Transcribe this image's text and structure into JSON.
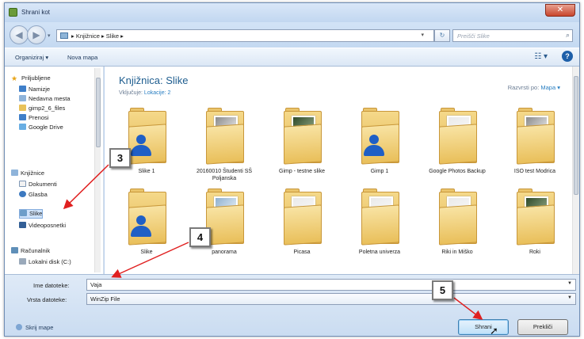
{
  "window": {
    "title": "Shrani kot",
    "close_symbol": "✕"
  },
  "address": {
    "crumbs": "▸ Knjižnice ▸ Slike ▸",
    "search_placeholder": "Preišči Slike",
    "back_symbol": "◀",
    "forward_symbol": "▶",
    "refresh_symbol": "↻",
    "search_symbol": "⌕",
    "dropdown_symbol": "▾"
  },
  "toolbar": {
    "organize": "Organiziraj ▾",
    "new_folder": "Nova mapa",
    "view_symbol": "☷ ▾",
    "help_symbol": "?"
  },
  "nav": {
    "favorites": "Priljubljene",
    "items": [
      {
        "label": "Namizje",
        "icon": "desktop-icon"
      },
      {
        "label": "Nedavna mesta",
        "icon": "recent-icon"
      },
      {
        "label": "gimp2_6_files",
        "icon": "folder-icon"
      },
      {
        "label": "Prenosi",
        "icon": "downloads-icon"
      },
      {
        "label": "Google Drive",
        "icon": "drive-icon"
      }
    ],
    "libraries": "Knjižnice",
    "library_items": [
      {
        "label": "Dokumenti",
        "icon": "document-icon"
      },
      {
        "label": "Glasba",
        "icon": "music-icon"
      },
      {
        "label": "Slike",
        "icon": "pictures-icon"
      },
      {
        "label": "Videoposnetki",
        "icon": "video-icon"
      }
    ],
    "computer": "Računalnik",
    "disk": "Lokalni disk (C:)"
  },
  "content": {
    "title": "Knjižnica: Slike",
    "includes_label": "Vključuje:",
    "includes_value": "Lokacije: 2",
    "arrange_label": "Razvrsti po:",
    "arrange_value": "Mapa ▾",
    "folders": [
      {
        "label": "Slike 1",
        "photo": "none",
        "user": true
      },
      {
        "label": "20160010 Študenti SŠ Poljanska",
        "photo": "grey",
        "user": false
      },
      {
        "label": "Gimp - testne slike",
        "photo": "dark",
        "user": false
      },
      {
        "label": "Gimp 1",
        "photo": "none",
        "user": true
      },
      {
        "label": "Google Photos Backup",
        "photo": "w",
        "user": false
      },
      {
        "label": "ISO test Modrica",
        "photo": "grey",
        "user": false
      },
      {
        "label": "Slike",
        "photo": "none",
        "user": true
      },
      {
        "label": "panorama",
        "photo": "blue",
        "user": false
      },
      {
        "label": "Picasa",
        "photo": "w",
        "user": false
      },
      {
        "label": "Poletna univerza",
        "photo": "w",
        "user": false
      },
      {
        "label": "Riki in Miško",
        "photo": "w",
        "user": false
      },
      {
        "label": "Roki",
        "photo": "dark",
        "user": false
      }
    ]
  },
  "form": {
    "name_label": "Ime datoteke:",
    "name_value": "Vaja",
    "type_label": "Vrsta datoteke:",
    "type_value": "WinZip File",
    "hide_folders": "Skrij mape",
    "save": "Shrani",
    "cancel": "Prekliči"
  },
  "annotations": {
    "step3": "3",
    "step4": "4",
    "step5": "5",
    "arrow_color": "#e02020"
  }
}
